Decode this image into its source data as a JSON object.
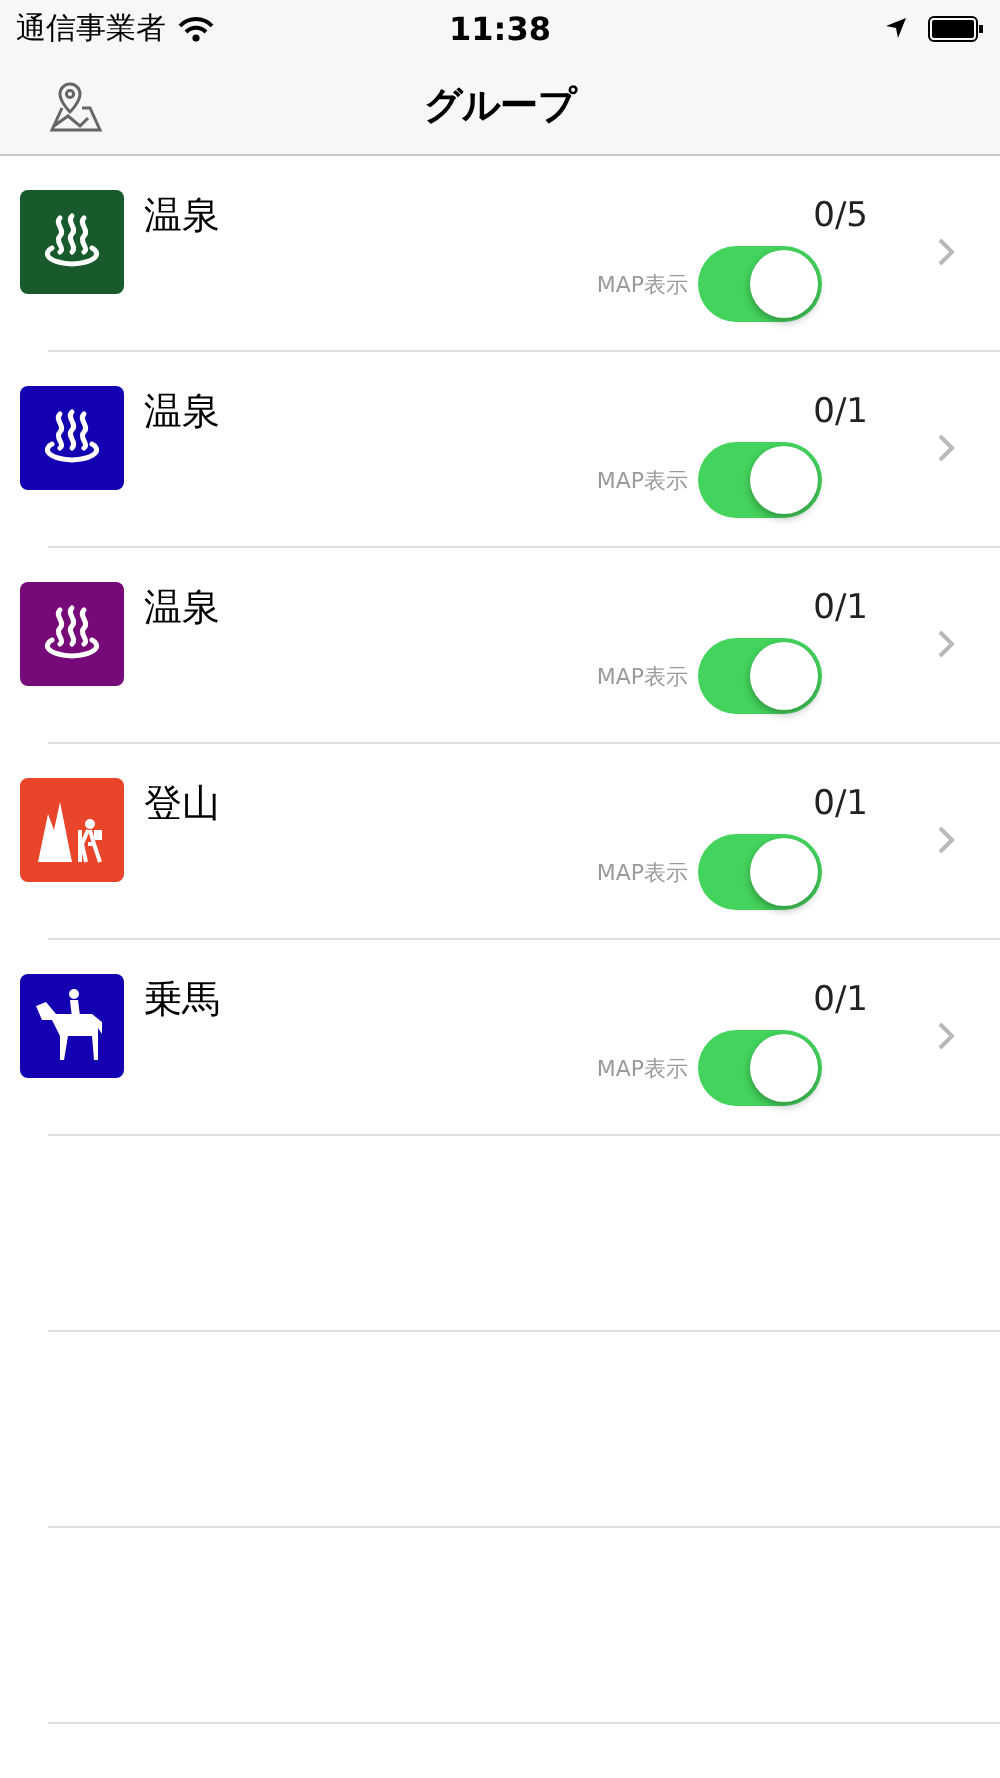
{
  "status_bar": {
    "carrier": "通信事業者",
    "time": "11:38"
  },
  "nav": {
    "title": "グループ"
  },
  "groups": [
    {
      "name": "温泉",
      "count": "0/5",
      "kind": "onsen",
      "color": "#185a2c",
      "map_label": "MAP表示",
      "on": true
    },
    {
      "name": "温泉",
      "count": "0/1",
      "kind": "onsen",
      "color": "#1400b0",
      "map_label": "MAP表示",
      "on": true
    },
    {
      "name": "温泉",
      "count": "0/1",
      "kind": "onsen",
      "color": "#760a78",
      "map_label": "MAP表示",
      "on": true
    },
    {
      "name": "登山",
      "count": "0/1",
      "kind": "hiking",
      "color": "#e8452a",
      "map_label": "MAP表示",
      "on": true
    },
    {
      "name": "乗馬",
      "count": "0/1",
      "kind": "horse",
      "color": "#1400b0",
      "map_label": "MAP表示",
      "on": true
    }
  ]
}
